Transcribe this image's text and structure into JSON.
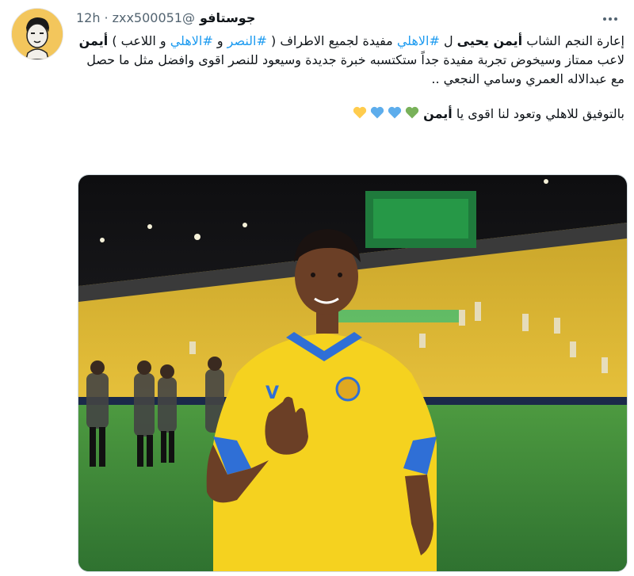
{
  "tweet": {
    "author_name": "جوستافو",
    "handle": "@zxx500051",
    "separator": "·",
    "time": "12h",
    "paragraph1": {
      "t1": "إعارة النجم الشاب ",
      "b1": "أيمن يحيى",
      "t2": " ل ",
      "h1": "#الاهلي",
      "t3": " مفيدة لجميع الاطراف ( ",
      "h2": "#النصر",
      "t4": " و ",
      "h3": "#الاهلي",
      "t5": " و اللاعب ) ",
      "b2": "أيمن",
      "t6": " لاعب ممتاز وسيخوض تجربة مفيدة جداً ستكتسبه خبرة جديدة وسيعود للنصر اقوى وافضل مثل ما حصل مع عبدالاله العمري وسامي النجعي .."
    },
    "paragraph2": {
      "t1": "بالتوفيق للاهلي وتعود لنا اقوى يا ",
      "b1": "أيمن"
    },
    "hearts": [
      "yellow-heart",
      "blue-heart",
      "blue-heart",
      "green-heart"
    ],
    "media": {
      "jersey_number": "V",
      "description_colors": {
        "jersey": "#f5d21f",
        "trim": "#2f6fd6",
        "pitch": "#3f8a3a",
        "stands": "#e8c23c"
      }
    }
  },
  "colors": {
    "hashtag": "#1d9bf0",
    "secondary": "#536471",
    "text": "#0f1419",
    "avatar_bg": "#f3c65c"
  }
}
